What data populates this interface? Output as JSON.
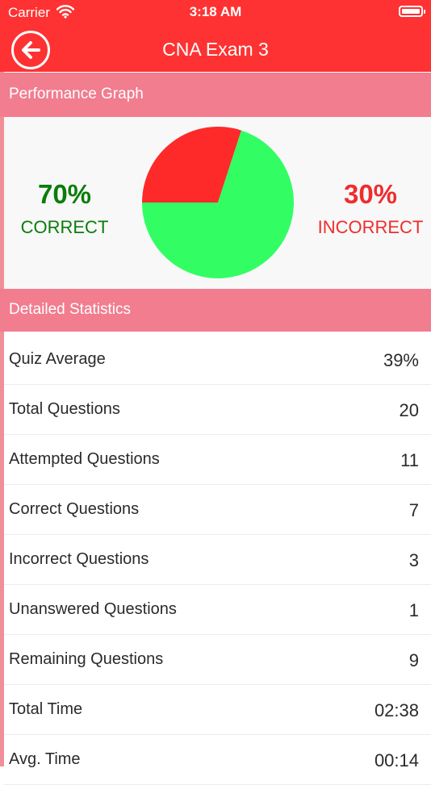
{
  "status_bar": {
    "carrier": "Carrier",
    "time": "3:18 AM"
  },
  "nav": {
    "title": "CNA Exam 3",
    "back_icon": "back-arrow-icon"
  },
  "performance": {
    "header": "Performance Graph",
    "correct_percent": "70%",
    "correct_label": "CORRECT",
    "incorrect_percent": "30%",
    "incorrect_label": "INCORRECT"
  },
  "chart_data": {
    "type": "pie",
    "slices": [
      {
        "label": "CORRECT",
        "value": 70,
        "color": "#32fe64"
      },
      {
        "label": "INCORRECT",
        "value": 30,
        "color": "#fe2a2a"
      }
    ]
  },
  "stats": {
    "header": "Detailed Statistics",
    "rows": [
      {
        "label": "Quiz Average",
        "value": "39%"
      },
      {
        "label": "Total Questions",
        "value": "20"
      },
      {
        "label": "Attempted Questions",
        "value": "11"
      },
      {
        "label": "Correct Questions",
        "value": "7"
      },
      {
        "label": "Incorrect Questions",
        "value": "3"
      },
      {
        "label": "Unanswered Questions",
        "value": "1"
      },
      {
        "label": "Remaining Questions",
        "value": "9"
      },
      {
        "label": "Total Time",
        "value": "02:38"
      },
      {
        "label": "Avg. Time",
        "value": "00:14"
      }
    ]
  },
  "colors": {
    "accent": "#fe3232",
    "section_header": "#f17d8f",
    "correct": "#0b7d0b",
    "incorrect": "#ef2d2d"
  }
}
